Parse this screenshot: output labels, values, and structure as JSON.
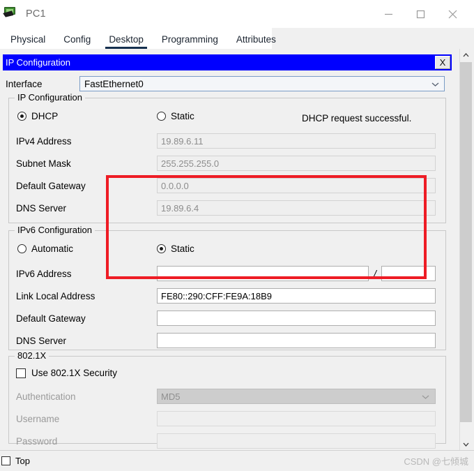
{
  "window": {
    "title": "PC1",
    "icon": "pc-device-icon",
    "controls": {
      "minimize": "minimize-icon",
      "maximize": "maximize-icon",
      "close": "close-icon"
    }
  },
  "tabs": [
    {
      "label": "Physical",
      "active": false
    },
    {
      "label": "Config",
      "active": false
    },
    {
      "label": "Desktop",
      "active": true
    },
    {
      "label": "Programming",
      "active": false
    },
    {
      "label": "Attributes",
      "active": false
    }
  ],
  "inner_window": {
    "title": "IP Configuration",
    "close_label": "X",
    "titlebar_color": "#0000ff"
  },
  "interface": {
    "label": "Interface",
    "value": "FastEthernet0"
  },
  "ipv4": {
    "legend": "IP Configuration",
    "mode_dhcp": "DHCP",
    "mode_static": "Static",
    "selected": "DHCP",
    "status": "DHCP request successful.",
    "fields": [
      {
        "label": "IPv4 Address",
        "value": "19.89.6.11"
      },
      {
        "label": "Subnet Mask",
        "value": "255.255.255.0"
      },
      {
        "label": "Default Gateway",
        "value": "0.0.0.0"
      },
      {
        "label": "DNS Server",
        "value": "19.89.6.4"
      }
    ]
  },
  "ipv6": {
    "legend": "IPv6 Configuration",
    "mode_auto": "Automatic",
    "mode_static": "Static",
    "selected": "Static",
    "address_label": "IPv6 Address",
    "address_value": "",
    "prefix_value": "",
    "slash": "/",
    "fields": [
      {
        "label": "Link Local Address",
        "value": "FE80::290:CFF:FE9A:18B9"
      },
      {
        "label": "Default Gateway",
        "value": ""
      },
      {
        "label": "DNS Server",
        "value": ""
      }
    ]
  },
  "dot1x": {
    "legend": "802.1X",
    "checkbox_label": "Use 802.1X Security",
    "checked": false,
    "fields": [
      {
        "label": "Authentication",
        "value": "MD5"
      },
      {
        "label": "Username",
        "value": ""
      },
      {
        "label": "Password",
        "value": ""
      }
    ]
  },
  "annotation": {
    "color": "#ee1c25"
  },
  "bottom": {
    "top_label": "Top",
    "top_checked": false,
    "watermark": "CSDN @七倾城"
  },
  "scrollbar": {
    "up": "chevron-up-icon",
    "down": "chevron-down-icon"
  }
}
